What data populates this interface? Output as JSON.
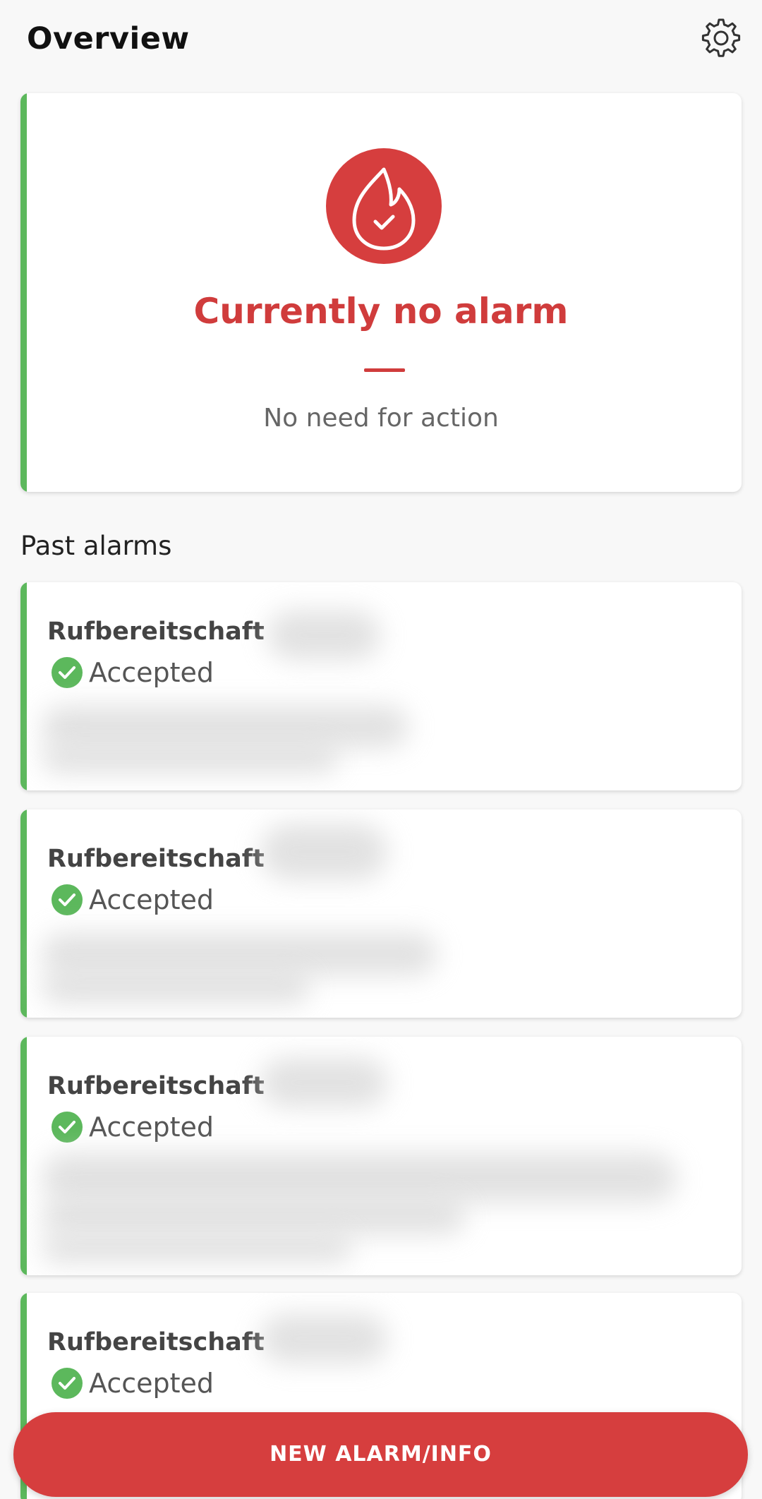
{
  "header": {
    "title": "Overview",
    "settings_icon": "gear-icon"
  },
  "status": {
    "icon": "flame-check-icon",
    "title": "Currently no alarm",
    "subtitle": "No need for action"
  },
  "past_alarms": {
    "title": "Past alarms",
    "items": [
      {
        "title": "Rufbereitschaft",
        "status": "Accepted"
      },
      {
        "title": "Rufbereitschaft",
        "status": "Accepted"
      },
      {
        "title": "Rufbereitschaft",
        "status": "Accepted"
      },
      {
        "title": "Rufbereitschaft",
        "status": "Accepted"
      }
    ]
  },
  "fab": {
    "label": "NEW ALARM/INFO"
  },
  "colors": {
    "accent_red": "#d63e3e",
    "success_green": "#5cb85c",
    "background": "#f8f8f8"
  }
}
